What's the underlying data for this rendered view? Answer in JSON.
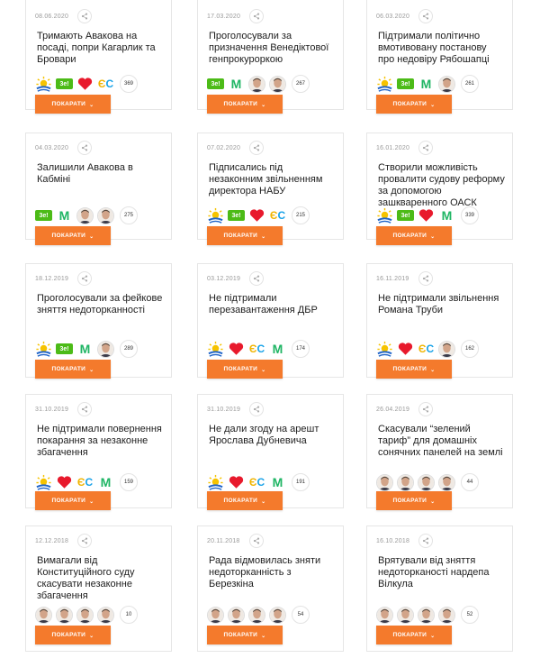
{
  "button_label": "ПОКАРАТИ",
  "button_chevron": "⌄",
  "colors": {
    "accent": "#f47a2c",
    "zel": "#4cbb17",
    "es_yellow": "#f0b400",
    "es_blue": "#1aa3e8",
    "heart": "#e8192c",
    "m": "#1fb564"
  },
  "cards": [
    {
      "date": "08.06.2020",
      "title": "Тримають Авакова на посаді, попри Кагарлик та Бровари",
      "icons": [
        "sun-party-icon",
        "zel-party-icon",
        "heart-party-icon",
        "es-party-icon"
      ],
      "count": "369"
    },
    {
      "date": "17.03.2020",
      "title": "Проголосували за призначення Венедіктової генпрокуроркою",
      "icons": [
        "zel-party-icon",
        "m-party-icon",
        "deputy-face-icon",
        "deputy-face-icon"
      ],
      "count": "267"
    },
    {
      "date": "06.03.2020",
      "title": "Підтримали політично вмотивовану постанову про недовіру Рябошапці",
      "icons": [
        "sun-party-icon",
        "zel-party-icon",
        "m-party-icon",
        "deputy-face-icon"
      ],
      "count": "261"
    },
    {
      "date": "04.03.2020",
      "title": "Залишили Авакова в Кабміні",
      "icons": [
        "zel-party-icon",
        "m-party-icon",
        "deputy-face-icon",
        "deputy-face-icon"
      ],
      "count": "275"
    },
    {
      "date": "07.02.2020",
      "title": "Підписались під незаконним звільненням директора НАБУ",
      "icons": [
        "sun-party-icon",
        "zel-party-icon",
        "heart-party-icon",
        "es-party-icon"
      ],
      "count": "215"
    },
    {
      "date": "16.01.2020",
      "title": "Створили можливість провалити судову реформу за допомогою зашкваренного ОАСК",
      "icons": [
        "sun-party-icon",
        "zel-party-icon",
        "heart-party-icon",
        "m-party-icon"
      ],
      "count": "339"
    },
    {
      "date": "18.12.2019",
      "title": "Проголосували за фейкове зняття недоторканності",
      "icons": [
        "sun-party-icon",
        "zel-party-icon",
        "m-party-icon",
        "deputy-face-icon"
      ],
      "count": "289"
    },
    {
      "date": "03.12.2019",
      "title": "Не підтримали перезавантаження ДБР",
      "icons": [
        "sun-party-icon",
        "heart-party-icon",
        "es-party-icon",
        "m-party-icon"
      ],
      "count": "174"
    },
    {
      "date": "16.11.2019",
      "title": "Не підтримали звільнення Романа Труби",
      "icons": [
        "sun-party-icon",
        "heart-party-icon",
        "es-party-icon",
        "deputy-face-icon"
      ],
      "count": "162"
    },
    {
      "date": "31.10.2019",
      "title": "Не підтримали повернення покарання за незаконне збагачення",
      "icons": [
        "sun-party-icon",
        "heart-party-icon",
        "es-party-icon",
        "m-party-icon"
      ],
      "count": "159"
    },
    {
      "date": "31.10.2019",
      "title": "Не дали згоду на арешт Ярослава Дубневича",
      "icons": [
        "sun-party-icon",
        "heart-party-icon",
        "es-party-icon",
        "m-party-icon"
      ],
      "count": "191"
    },
    {
      "date": "26.04.2019",
      "title": "Скасували “зелений тариф” для домашніх сонячних панелей на землі",
      "icons": [
        "deputy-face-icon",
        "deputy-face-icon",
        "deputy-face-icon",
        "deputy-face-icon"
      ],
      "count": "44"
    },
    {
      "date": "12.12.2018",
      "title": "Вимагали від Конституційного суду скасувати незаконне збагачення",
      "icons": [
        "deputy-face-icon",
        "deputy-face-icon",
        "deputy-face-icon",
        "deputy-face-icon"
      ],
      "count": "10"
    },
    {
      "date": "20.11.2018",
      "title": "Рада відмовилась зняти недоторканність з Березкіна",
      "icons": [
        "deputy-face-icon",
        "deputy-face-icon",
        "deputy-face-icon",
        "deputy-face-icon"
      ],
      "count": "54"
    },
    {
      "date": "16.10.2018",
      "title": "Врятували від зняття недоторканості нардепа Вілкула",
      "icons": [
        "deputy-face-icon",
        "deputy-face-icon",
        "deputy-face-icon",
        "deputy-face-icon"
      ],
      "count": "52"
    }
  ]
}
